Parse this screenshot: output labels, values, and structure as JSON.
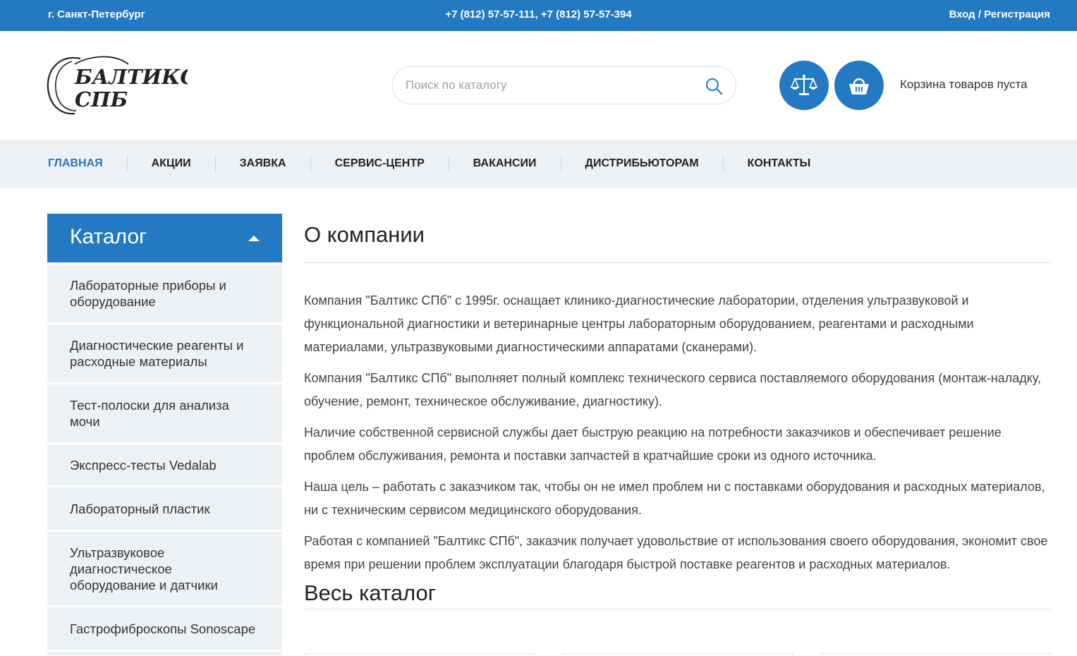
{
  "topbar": {
    "city": "г. Санкт-Петербург",
    "phones": "+7 (812) 57-57-111, +7 (812) 57-57-394",
    "auth": "Вход / Регистрация"
  },
  "header": {
    "logo_line1": "БАЛТИКС",
    "logo_line2": "СПБ",
    "search_placeholder": "Поиск по каталогу",
    "cart_status": "Корзина товаров пуста",
    "icons": {
      "search": "search-icon",
      "compare": "scales-icon",
      "cart": "basket-icon"
    }
  },
  "nav": {
    "items": [
      {
        "label": "ГЛАВНАЯ",
        "active": true
      },
      {
        "label": "АКЦИИ"
      },
      {
        "label": "ЗАЯВКА"
      },
      {
        "label": "СЕРВИС-ЦЕНТР"
      },
      {
        "label": "ВАКАНСИИ"
      },
      {
        "label": "ДИСТРИБЬЮТОРАМ"
      },
      {
        "label": "КОНТАКТЫ"
      }
    ]
  },
  "sidebar": {
    "title": "Каталог",
    "items": [
      {
        "label": "Лабораторные приборы и оборудование"
      },
      {
        "label": "Диагностические реагенты и расходные материалы"
      },
      {
        "label": "Тест-полоски для анализа мочи"
      },
      {
        "label": "Экспресс-тесты Vedalab"
      },
      {
        "label": "Лабораторный пластик"
      },
      {
        "label": "Ультразвуковое диагностическое оборудование и датчики"
      },
      {
        "label": "Гастрофиброскопы Sonoscape"
      }
    ]
  },
  "main": {
    "title": "О компании",
    "paragraphs": [
      "Компания \"Балтикс СПб\" с 1995г. оснащает клинико-диагностические лаборатории, отделения ультразвуковой и функциональной диагностики и ветеринарные центры лабораторным оборудованием, реагентами и расходными материалами, ультразвуковыми диагностическими аппаратами (сканерами).",
      "Компания \"Балтикс СПб\" выполняет полный комплекс технического сервиса поставляемого оборудования (монтаж-наладку, обучение, ремонт, техническое обслуживание, диагностику).",
      "Наличие собственной сервисной службы дает быструю реакцию на потребности заказчиков и обеспечивает решение проблем обслуживания, ремонта и поставки запчастей в кратчайшие сроки из одного источника.",
      "Наша цель – работать с заказчиком так, чтобы он не имел проблем ни с поставками оборудования и расходных материалов, ни с техническим сервисом медицинского оборудования.",
      "Работая с компанией \"Балтикс СПб\", заказчик получает удовольствие от использования своего оборудования, экономит свое время при решении проблем  эксплуатации благодаря быстрой поставке реагентов и расходных материалов."
    ],
    "catalog_title": "Весь каталог"
  },
  "colors": {
    "accent": "#2379c2",
    "nav_bg": "#eef1f4"
  }
}
